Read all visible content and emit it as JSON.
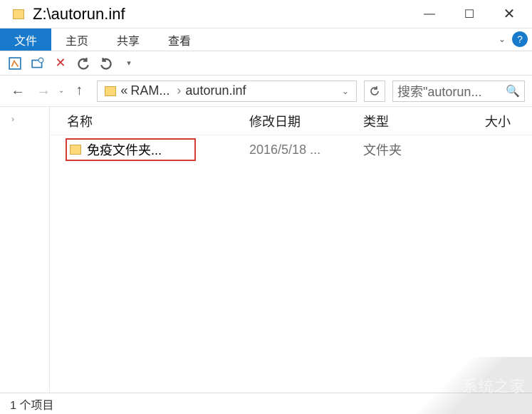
{
  "window": {
    "title": "Z:\\autorun.inf"
  },
  "ribbon": {
    "tabs": {
      "file": "文件",
      "home": "主页",
      "share": "共享",
      "view": "查看"
    }
  },
  "breadcrumb": {
    "part1": "RAM...",
    "part2": "autorun.inf",
    "chevron_left": "«",
    "chevron_sep": "›"
  },
  "search": {
    "placeholder": "搜索\"autorun..."
  },
  "columns": {
    "name": "名称",
    "modified": "修改日期",
    "type": "类型",
    "size": "大小"
  },
  "files": [
    {
      "name": "免疫文件夹...",
      "modified": "2016/5/18 ...",
      "type": "文件夹"
    }
  ],
  "statusbar": {
    "items": "1 个项目"
  },
  "watermark": "系统之家"
}
